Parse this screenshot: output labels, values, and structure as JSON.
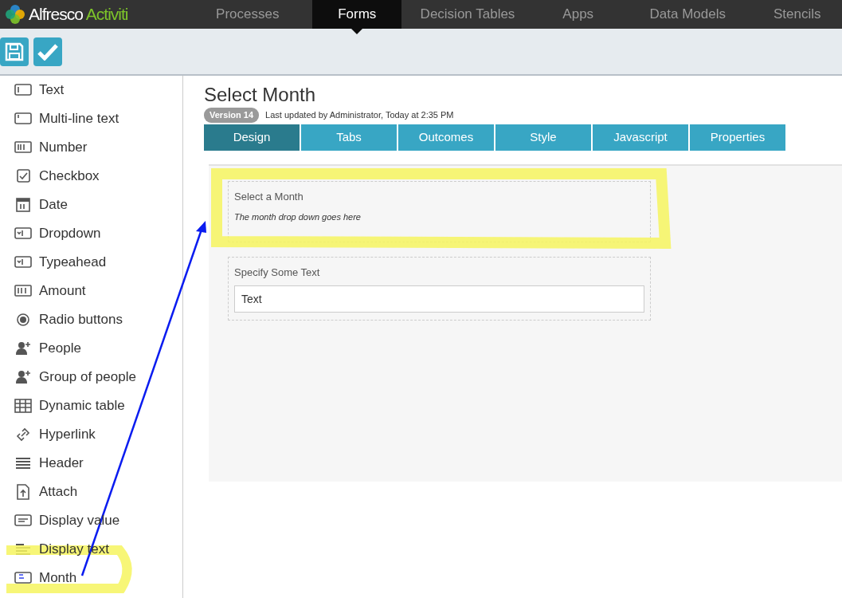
{
  "brand": {
    "name": "Alfresco",
    "product": "Activiti"
  },
  "nav": [
    {
      "label": "Processes",
      "selected": false
    },
    {
      "label": "Forms",
      "selected": true
    },
    {
      "label": "Decision Tables",
      "selected": false
    },
    {
      "label": "Apps",
      "selected": false
    },
    {
      "label": "Data Models",
      "selected": false
    },
    {
      "label": "Stencils",
      "selected": false
    }
  ],
  "palette": [
    {
      "label": "Text",
      "kind": "text"
    },
    {
      "label": "Multi-line text",
      "kind": "multiline"
    },
    {
      "label": "Number",
      "kind": "number"
    },
    {
      "label": "Checkbox",
      "kind": "checkbox"
    },
    {
      "label": "Date",
      "kind": "date"
    },
    {
      "label": "Dropdown",
      "kind": "dropdown"
    },
    {
      "label": "Typeahead",
      "kind": "dropdown"
    },
    {
      "label": "Amount",
      "kind": "amount"
    },
    {
      "label": "Radio buttons",
      "kind": "radio"
    },
    {
      "label": "People",
      "kind": "person"
    },
    {
      "label": "Group of people",
      "kind": "person"
    },
    {
      "label": "Dynamic table",
      "kind": "table"
    },
    {
      "label": "Hyperlink",
      "kind": "link"
    },
    {
      "label": "Header",
      "kind": "header"
    },
    {
      "label": "Attach",
      "kind": "attach"
    },
    {
      "label": "Display value",
      "kind": "display"
    },
    {
      "label": "Display text",
      "kind": "lines"
    },
    {
      "label": "Month",
      "kind": "month"
    }
  ],
  "form": {
    "title": "Select Month",
    "version": "Version 14",
    "updated": "Last updated by Administrator, Today at 2:35 PM"
  },
  "tabs": [
    {
      "label": "Design",
      "selected": true
    },
    {
      "label": "Tabs",
      "selected": false
    },
    {
      "label": "Outcomes",
      "selected": false
    },
    {
      "label": "Style",
      "selected": false
    },
    {
      "label": "Javascript",
      "selected": false
    },
    {
      "label": "Properties",
      "selected": false
    }
  ],
  "fields": [
    {
      "kind": "display_text",
      "label": "Select a Month",
      "text": "The month drop down goes here"
    },
    {
      "kind": "text",
      "label": "Specify Some Text",
      "placeholder": "Text"
    }
  ]
}
